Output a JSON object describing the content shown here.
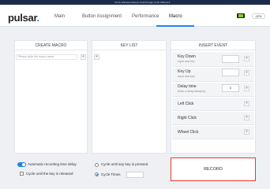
{
  "topbar": {
    "info": "X2 DL Wireless   Mouse v3.22   Dongle v3.20   Offline/UI"
  },
  "header": {
    "logo_text": "pulsar",
    "logo_dot": ".",
    "tabs": [
      {
        "label": "Main"
      },
      {
        "label": "Button Assignment"
      },
      {
        "label": "Performance"
      },
      {
        "label": "Macro"
      }
    ],
    "battery": "42%"
  },
  "create_macro": {
    "title": "CREATE MACRO",
    "placeholder": "Please write the macro name",
    "add": "+"
  },
  "key_list": {
    "title": "KEY LIST",
    "add": "+"
  },
  "insert_event": {
    "title": "INSERT EVENT",
    "key_down": {
      "label": "Key Down",
      "sub": "Input new key",
      "add": "+"
    },
    "key_up": {
      "label": "Key Up",
      "sub": "Input new key",
      "add": "+"
    },
    "delay": {
      "label": "Delay time",
      "sub": "Enter a delay time(ms)",
      "value": "0",
      "add": "+"
    },
    "left_click": {
      "label": "Left Click",
      "add": "+"
    },
    "right_click": {
      "label": "Right Click",
      "add": "+"
    },
    "wheel_click": {
      "label": "Wheel Click",
      "add": "+"
    }
  },
  "options": {
    "auto_delay": "Automatic recording time delay",
    "cycle_until_pressed": "Cycle until any key is pressed",
    "cycle_until_released": "Cycle until the key is released",
    "cycle_times": "Cycle Times"
  },
  "record": {
    "label": "RECORD"
  }
}
